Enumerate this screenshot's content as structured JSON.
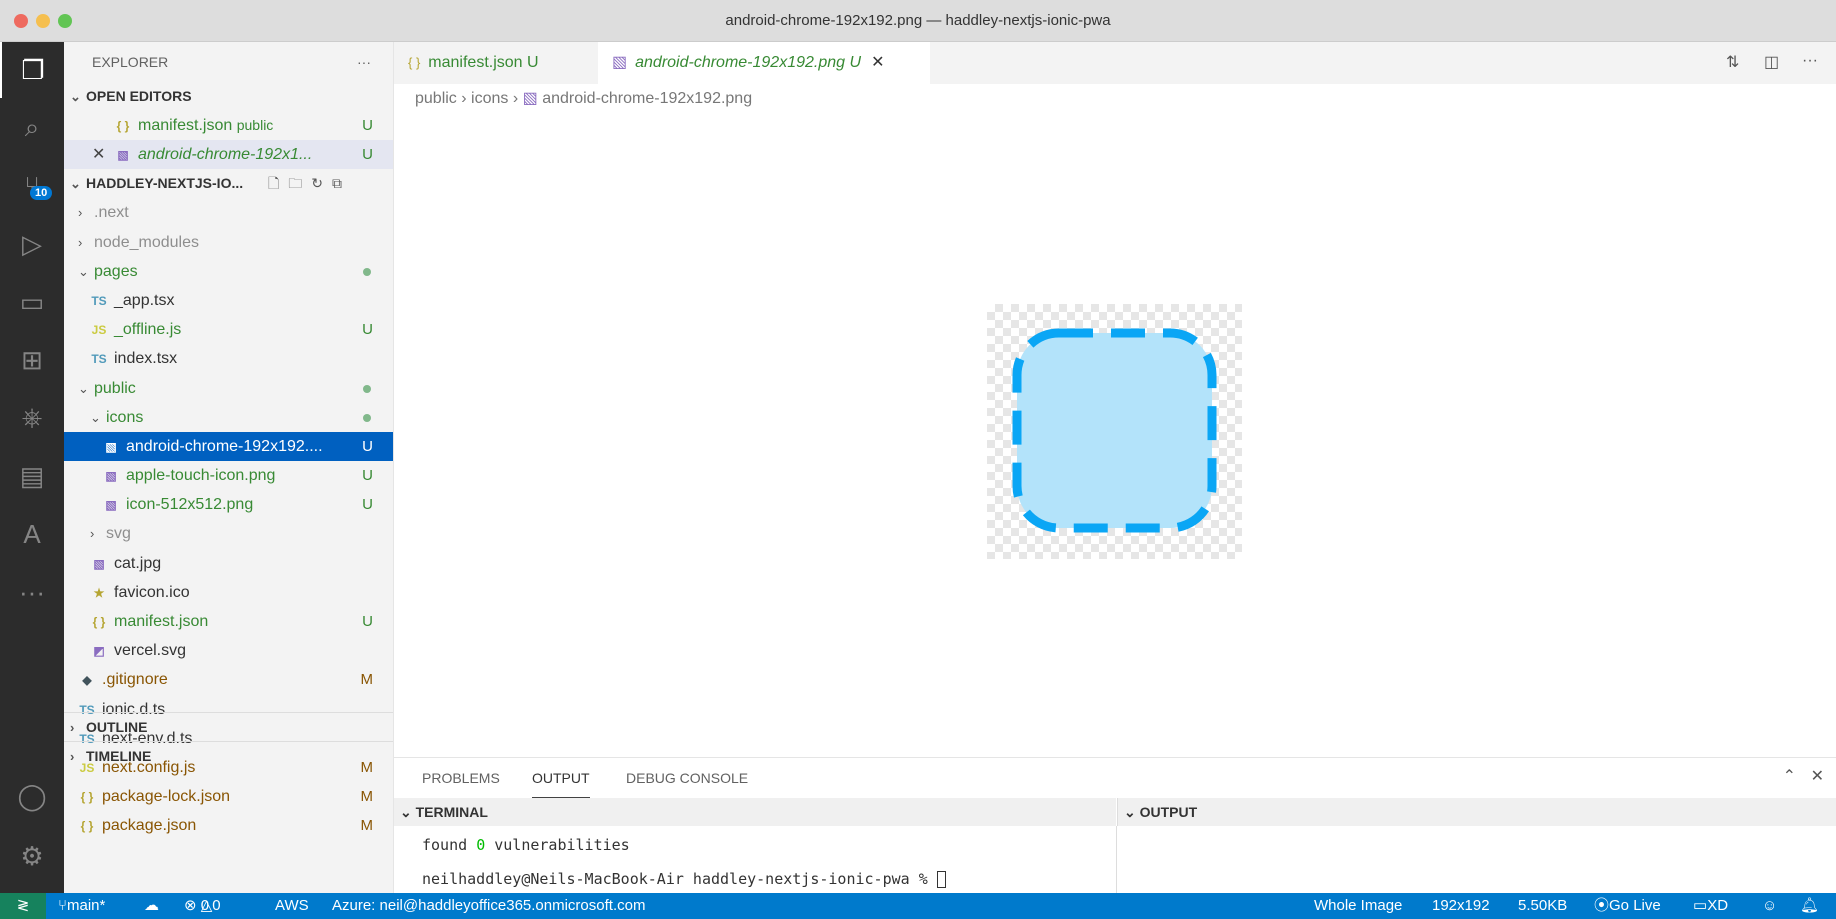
{
  "window": {
    "title": "android-chrome-192x192.png — haddley-nextjs-ionic-pwa"
  },
  "activity": {
    "scm_badge": "10"
  },
  "sidebar": {
    "title": "EXPLORER",
    "more": "···",
    "open_editors": "OPEN EDITORS",
    "project": "HADDLEY-NEXTJS-IO...",
    "outline": "OUTLINE",
    "timeline": "TIMELINE",
    "open_files": [
      {
        "name": "manifest.json",
        "desc": "public",
        "icon": "{ }",
        "iconColor": "#b5a532",
        "badge": "U",
        "italic": false,
        "close": ""
      },
      {
        "name": "android-chrome-192x1...",
        "desc": "",
        "icon": "▧",
        "iconColor": "#8a6cc0",
        "badge": "U",
        "italic": true,
        "close": "✕"
      }
    ],
    "tree": [
      {
        "name": ".next",
        "level": 0,
        "type": "folder",
        "open": false,
        "color": "#8e8e8e"
      },
      {
        "name": "node_modules",
        "level": 0,
        "type": "folder",
        "open": false,
        "color": "#8e8e8e"
      },
      {
        "name": "pages",
        "level": 0,
        "type": "folder",
        "open": true,
        "color": "#388a34",
        "dot": true
      },
      {
        "name": "_app.tsx",
        "level": 1,
        "type": "file",
        "icon": "TS",
        "iconColor": "#519aba",
        "color": "#333"
      },
      {
        "name": "_offline.js",
        "level": 1,
        "type": "file",
        "icon": "JS",
        "iconColor": "#cbcb41",
        "color": "#388a34",
        "badge": "U"
      },
      {
        "name": "index.tsx",
        "level": 1,
        "type": "file",
        "icon": "TS",
        "iconColor": "#519aba",
        "color": "#333"
      },
      {
        "name": "public",
        "level": 0,
        "type": "folder",
        "open": true,
        "color": "#388a34",
        "dot": true
      },
      {
        "name": "icons",
        "level": 1,
        "type": "folder",
        "open": true,
        "color": "#388a34",
        "dot": true
      },
      {
        "name": "android-chrome-192x192....",
        "level": 2,
        "type": "file",
        "icon": "▧",
        "iconColor": "#8a6cc0",
        "color": "#fff",
        "badge": "U",
        "selected": true
      },
      {
        "name": "apple-touch-icon.png",
        "level": 2,
        "type": "file",
        "icon": "▧",
        "iconColor": "#8a6cc0",
        "color": "#388a34",
        "badge": "U"
      },
      {
        "name": "icon-512x512.png",
        "level": 2,
        "type": "file",
        "icon": "▧",
        "iconColor": "#8a6cc0",
        "color": "#388a34",
        "badge": "U"
      },
      {
        "name": "svg",
        "level": 1,
        "type": "folder",
        "open": false,
        "color": "#8e8e8e"
      },
      {
        "name": "cat.jpg",
        "level": 1,
        "type": "file",
        "icon": "▧",
        "iconColor": "#8a6cc0",
        "color": "#333"
      },
      {
        "name": "favicon.ico",
        "level": 1,
        "type": "file",
        "icon": "★",
        "iconColor": "#b5a532",
        "color": "#333"
      },
      {
        "name": "manifest.json",
        "level": 1,
        "type": "file",
        "icon": "{ }",
        "iconColor": "#b5a532",
        "color": "#388a34",
        "badge": "U"
      },
      {
        "name": "vercel.svg",
        "level": 1,
        "type": "file",
        "icon": "◩",
        "iconColor": "#8a6cc0",
        "color": "#333"
      },
      {
        "name": ".gitignore",
        "level": 0,
        "type": "file",
        "icon": "◆",
        "iconColor": "#41535b",
        "color": "#895503",
        "badge": "M"
      },
      {
        "name": "ionic.d.ts",
        "level": 0,
        "type": "file",
        "icon": "TS",
        "iconColor": "#519aba",
        "color": "#333"
      },
      {
        "name": "next-env.d.ts",
        "level": 0,
        "type": "file",
        "icon": "TS",
        "iconColor": "#519aba",
        "color": "#333"
      },
      {
        "name": "next.config.js",
        "level": 0,
        "type": "file",
        "icon": "JS",
        "iconColor": "#cbcb41",
        "color": "#895503",
        "badge": "M"
      },
      {
        "name": "package-lock.json",
        "level": 0,
        "type": "file",
        "icon": "{ }",
        "iconColor": "#b5a532",
        "color": "#895503",
        "badge": "M"
      },
      {
        "name": "package.json",
        "level": 0,
        "type": "file",
        "icon": "{ }",
        "iconColor": "#b5a532",
        "color": "#895503",
        "badge": "M"
      }
    ]
  },
  "tabs": [
    {
      "label": "manifest.json",
      "badge": "U"
    },
    {
      "label": "android-chrome-192x192.png",
      "badge": "U"
    }
  ],
  "breadcrumb": [
    "public",
    "icons",
    "android-chrome-192x192.png"
  ],
  "panel": {
    "tabs": [
      "PROBLEMS",
      "OUTPUT",
      "DEBUG CONSOLE"
    ],
    "terminal_title": "TERMINAL",
    "output_title": "OUTPUT",
    "line1_a": "found ",
    "line1_b": "0",
    "line1_c": " vulnerabilities",
    "prompt": "neilhaddley@Neils-MacBook-Air haddley-nextjs-ionic-pwa % "
  },
  "status": {
    "branch": "main*",
    "errors": "0",
    "warnings": "0",
    "aws": "AWS",
    "azure": "Azure: neil@haddleyoffice365.onmicrosoft.com",
    "mode": "Whole Image",
    "dims": "192x192",
    "size": "5.50KB",
    "golive": "Go Live",
    "xd": "XD"
  }
}
